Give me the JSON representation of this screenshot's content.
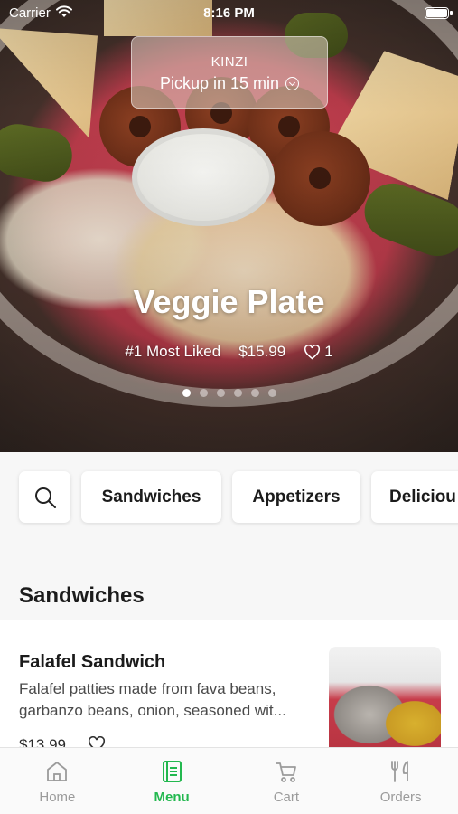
{
  "status_bar": {
    "carrier": "Carrier",
    "time": "8:16 PM"
  },
  "pickup": {
    "store": "KINZI",
    "eta": "Pickup in 15 min"
  },
  "hero": {
    "title": "Veggie Plate",
    "tag": "#1 Most Liked",
    "price": "$15.99",
    "likes": "1",
    "slides_total": 6,
    "slide_active": 1
  },
  "categories": {
    "items": [
      "Sandwiches",
      "Appetizers",
      "Deliciou"
    ]
  },
  "section": {
    "title": "Sandwiches"
  },
  "menu_item": {
    "name": "Falafel Sandwich",
    "description": "Falafel patties made from fava beans, garbanzo beans, onion, seasoned wit...",
    "price": "$13.99"
  },
  "tabs": [
    {
      "label": "Home",
      "icon": "home-icon",
      "active": false
    },
    {
      "label": "Menu",
      "icon": "menu-icon",
      "active": true
    },
    {
      "label": "Cart",
      "icon": "cart-icon",
      "active": false
    },
    {
      "label": "Orders",
      "icon": "orders-icon",
      "active": false
    }
  ],
  "colors": {
    "accent": "#23b84f",
    "inactive_tab": "#9b9b9b"
  }
}
